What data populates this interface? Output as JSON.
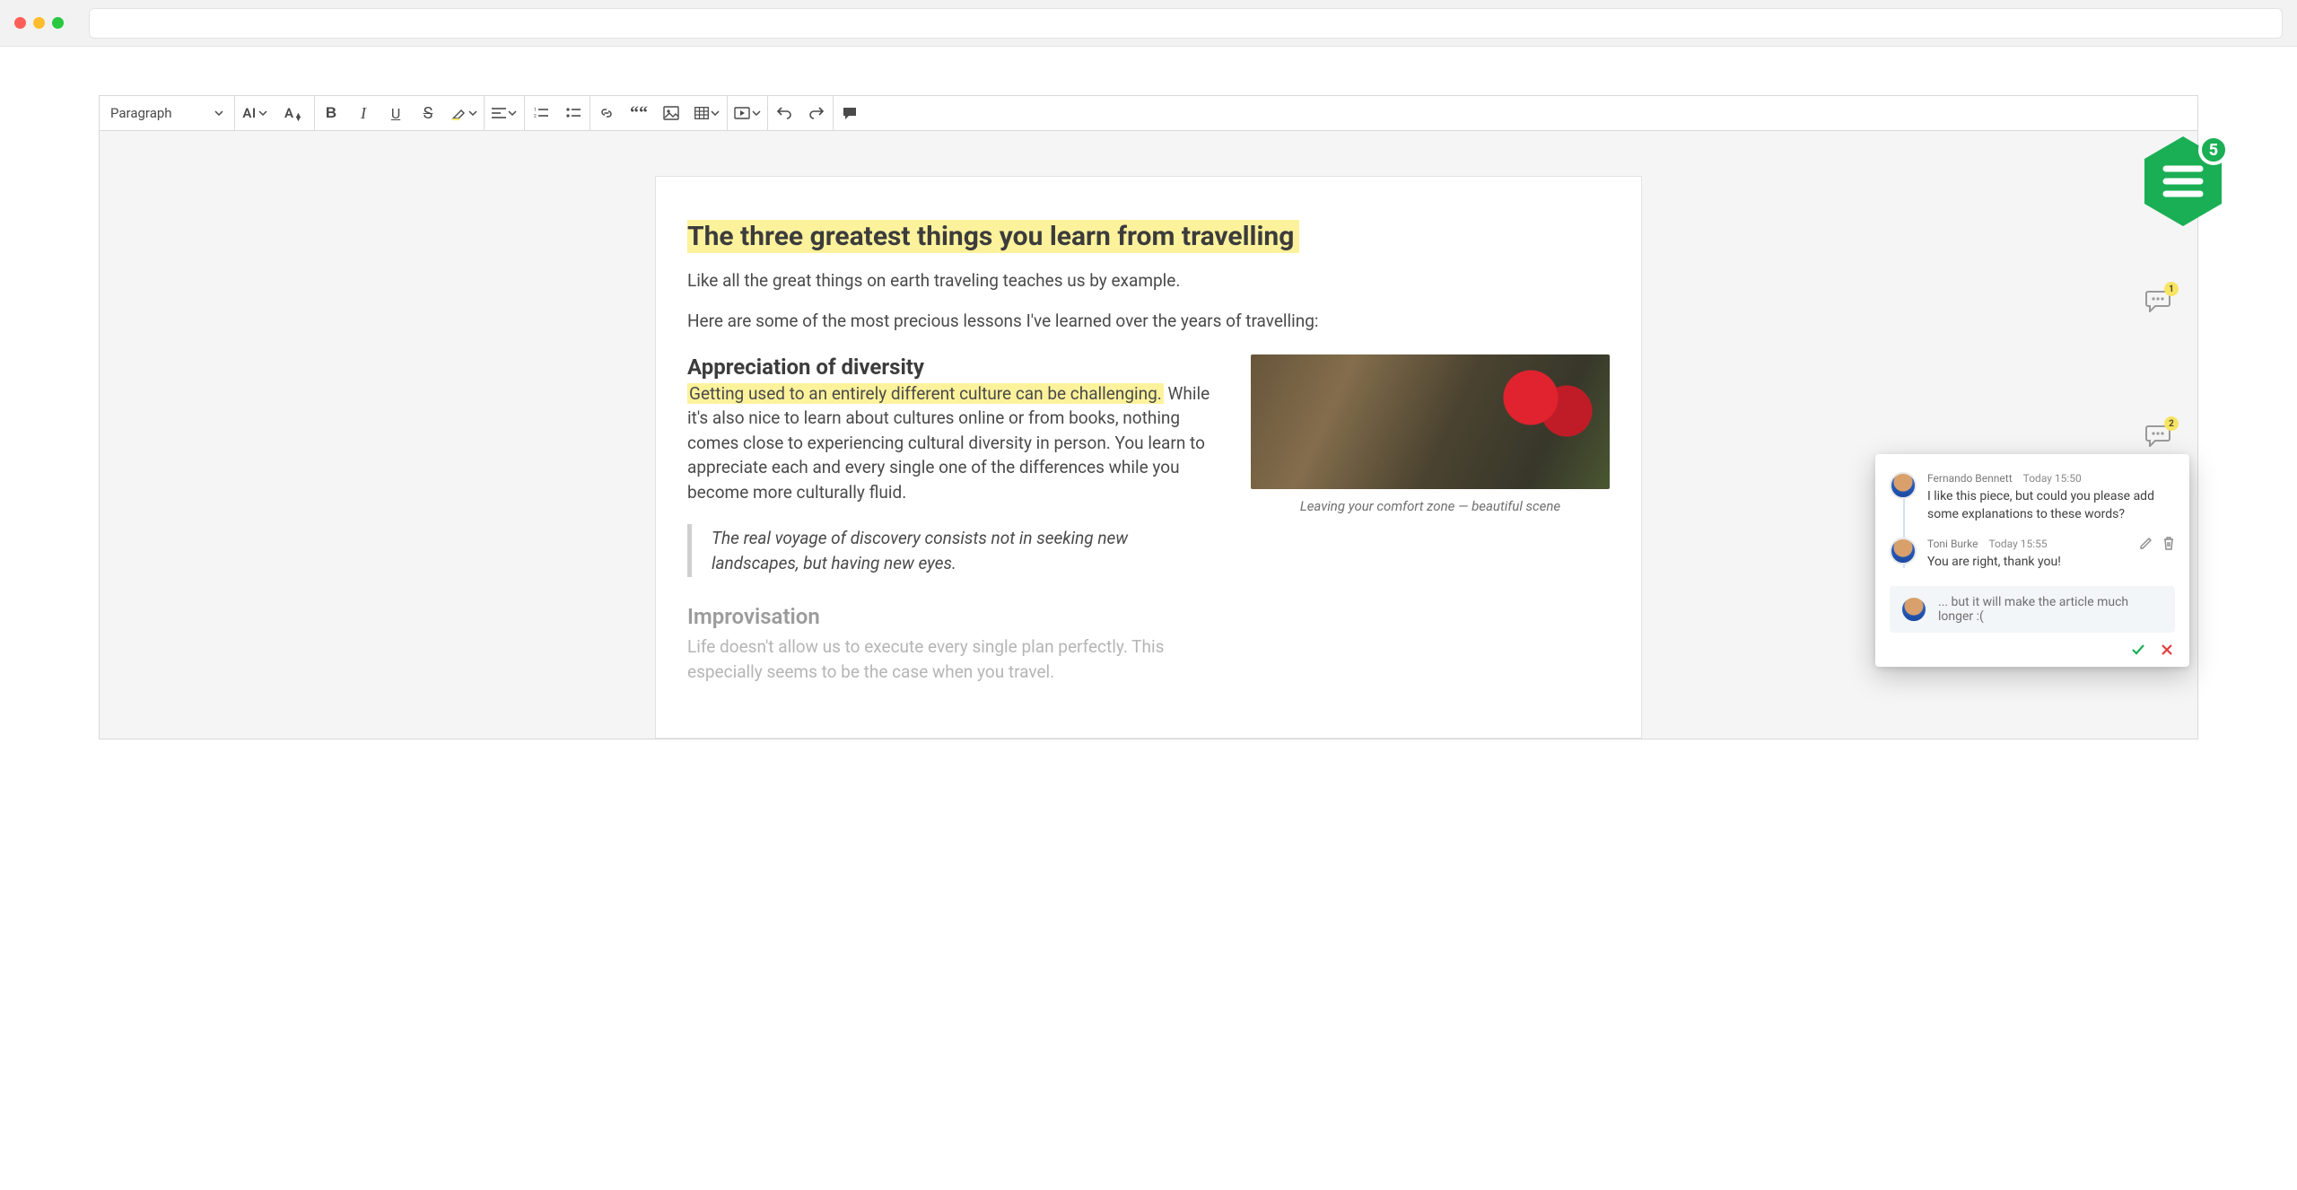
{
  "toolbar": {
    "heading_label": "Paragraph",
    "ai_label": "AI"
  },
  "hex_badge": {
    "count": "5"
  },
  "markers": {
    "m1": {
      "count": "1"
    },
    "m2": {
      "count": "2"
    }
  },
  "document": {
    "title": "The three greatest things you learn from travelling",
    "lead1": "Like all the great things on earth traveling teaches us by example.",
    "lead2": "Here are some of the most precious lessons I've learned over the years of travelling:",
    "section1": {
      "heading": "Appreciation of diversity",
      "highlight": "Getting used to an entirely different culture can be challenging.",
      "rest": " While it's also nice to learn about cultures online or from books, nothing comes close to experiencing cultural diversity in person. You learn to appreciate each and every single one of the differences while you become more culturally fluid."
    },
    "figure_caption": "Leaving your comfort zone — beautiful scene",
    "quote": "The real voyage of discovery consists not in seeking new landscapes, but having new eyes.",
    "section2": {
      "heading": "Improvisation",
      "body": "Life doesn't allow us to execute every single plan perfectly. This especially seems to be the case when you travel."
    }
  },
  "thread": {
    "comments": [
      {
        "name": "Fernando Bennett",
        "time": "Today 15:50",
        "text": "I like this piece, but could you please add some explanations to these words?"
      },
      {
        "name": "Toni Burke",
        "time": "Today 15:55",
        "text": "You are right, thank you!"
      }
    ],
    "reply_draft": "... but it will make the article much longer :("
  }
}
